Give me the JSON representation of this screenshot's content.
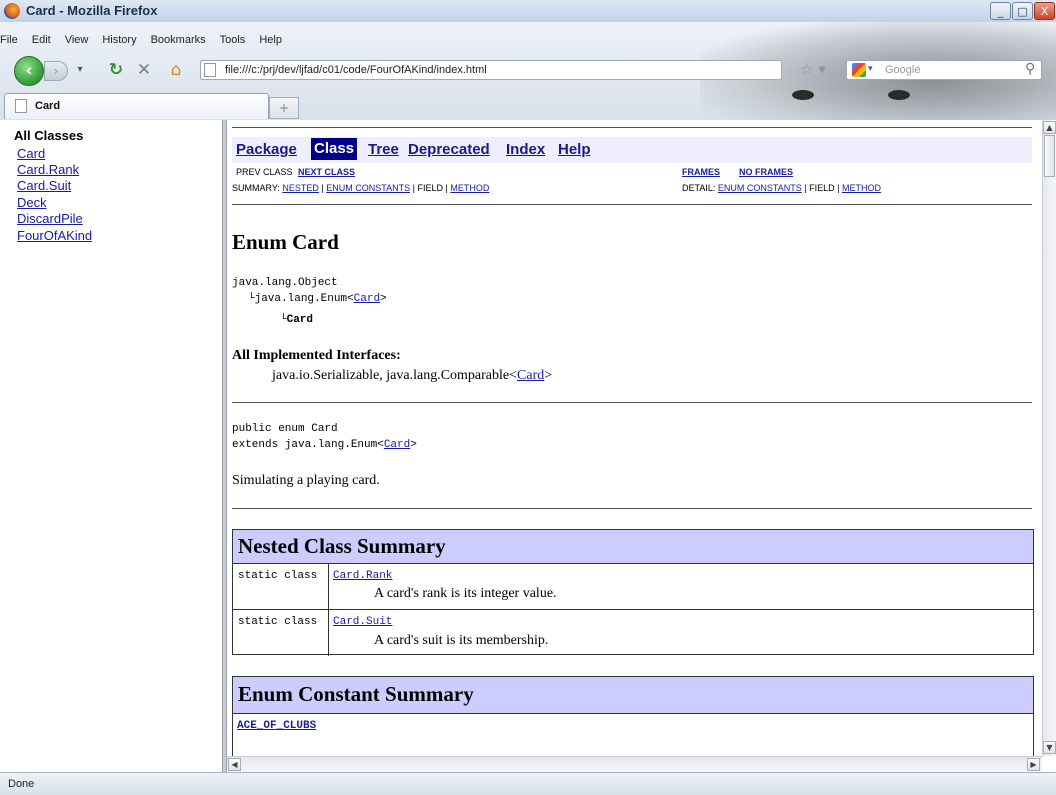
{
  "window": {
    "title": "Card - Mozilla Firefox",
    "buttons": {
      "minimize": "_",
      "maximize": "□",
      "close": "X"
    }
  },
  "menubar": [
    "File",
    "Edit",
    "View",
    "History",
    "Bookmarks",
    "Tools",
    "Help"
  ],
  "navigation": {
    "url": "file:///c:/prj/dev/ljfad/c01/code/FourOfAKind/index.html",
    "search_placeholder": "Google"
  },
  "tabs": [
    {
      "label": "Card"
    }
  ],
  "left_frame": {
    "heading": "All Classes",
    "classes": [
      "Card",
      "Card.Rank",
      "Card.Suit",
      "Deck",
      "DiscardPile",
      "FourOfAKind"
    ]
  },
  "javadoc": {
    "nav": {
      "package": "Package",
      "class": "Class",
      "tree": "Tree",
      "deprecated": "Deprecated",
      "index": "Index",
      "help": "Help"
    },
    "sub_nav": {
      "prev_class": "PREV CLASS",
      "next_class": "NEXT CLASS",
      "frames": "FRAMES",
      "no_frames": "NO FRAMES",
      "summary_label": "SUMMARY:",
      "summary_nested": "NESTED",
      "summary_enum_constants": "ENUM CONSTANTS",
      "summary_field": "FIELD",
      "summary_method": "METHOD",
      "detail_label": "DETAIL:",
      "detail_enum_constants": "ENUM CONSTANTS",
      "detail_field": "FIELD",
      "detail_method": "METHOD",
      "sep": "|"
    },
    "title": "Enum Card",
    "hierarchy": {
      "object": "java.lang.Object",
      "enum_prefix": "java.lang.Enum<",
      "enum_link": "Card",
      "enum_suffix": ">",
      "leaf": "Card"
    },
    "interfaces": {
      "heading": "All Implemented Interfaces:",
      "prefix": "java.io.Serializable, java.lang.Comparable<",
      "link": "Card",
      "suffix": ">"
    },
    "declaration": {
      "line1": "public enum Card",
      "line2_prefix": "extends java.lang.Enum<",
      "line2_link": "Card",
      "line2_suffix": ">"
    },
    "description": "Simulating a playing card.",
    "nested_summary": {
      "heading": "Nested Class Summary",
      "rows": [
        {
          "modifier": "static class",
          "name": "Card.Rank",
          "desc": "A card's rank is its integer value."
        },
        {
          "modifier": "static class",
          "name": "Card.Suit",
          "desc": "A card's suit is its membership."
        }
      ]
    },
    "enum_constant_summary": {
      "heading": "Enum Constant Summary",
      "first_constant": "ACE_OF_CLUBS"
    }
  },
  "status": "Done"
}
